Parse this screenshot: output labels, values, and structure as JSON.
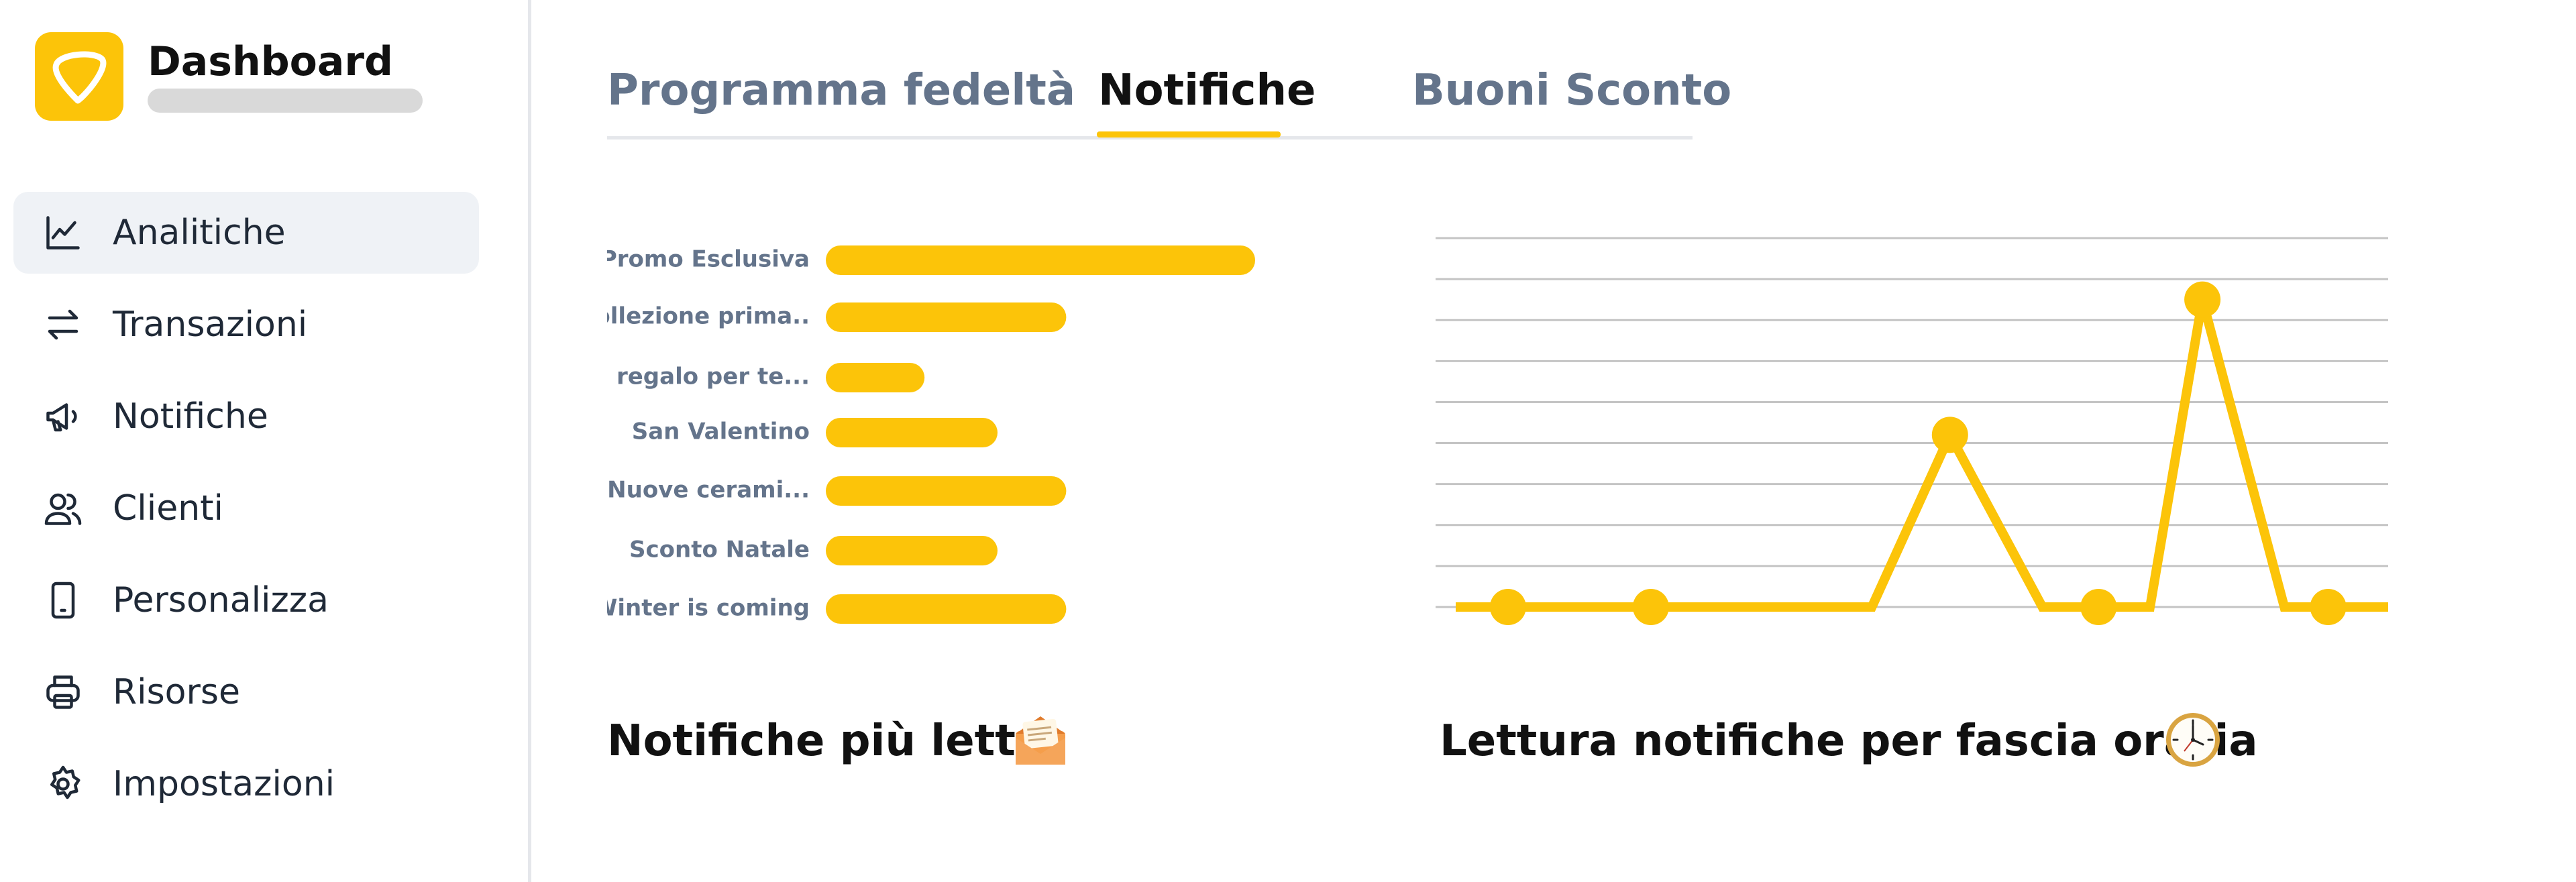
{
  "brand": {
    "title": "Dashboard"
  },
  "sidebar": {
    "items": [
      {
        "label": "Analitiche",
        "icon": "chart-line-icon",
        "active": true
      },
      {
        "label": "Transazioni",
        "icon": "arrows-exchange-icon"
      },
      {
        "label": "Notifiche",
        "icon": "megaphone-icon"
      },
      {
        "label": "Clienti",
        "icon": "users-icon"
      },
      {
        "label": "Personalizza",
        "icon": "smartphone-icon"
      },
      {
        "label": "Risorse",
        "icon": "printer-icon"
      },
      {
        "label": "Impostazioni",
        "icon": "gear-icon"
      }
    ]
  },
  "tabs": [
    {
      "label": "Programma fedeltà"
    },
    {
      "label": "Notifiche",
      "active": true
    },
    {
      "label": "Buoni Sconto"
    }
  ],
  "colors": {
    "accent": "#fcc409",
    "grid": "#c4c4c4",
    "muted_text": "#64748b"
  },
  "chart_data": [
    {
      "type": "bar",
      "orientation": "horizontal",
      "categories": [
        "Promo Esclusiva",
        "Collezione prima..",
        "Un regalo per te...",
        "San Valentino",
        "Nuove cerami...",
        "Sconto Natale",
        "Winter is coming"
      ],
      "values": [
        100,
        56,
        23,
        40,
        56,
        40,
        56
      ],
      "title": "Notifiche più lette",
      "title_icon": "envelope-letter-icon",
      "xlim": [
        0,
        100
      ]
    },
    {
      "type": "line",
      "x": [
        0,
        1,
        2,
        3,
        4,
        5,
        6,
        7,
        8,
        9,
        10,
        11,
        12
      ],
      "values": [
        0,
        0,
        0,
        0,
        0,
        0,
        0.75,
        0,
        0,
        0,
        0.75,
        0,
        0
      ],
      "series": [
        {
          "x": [
            0.0,
            0.076,
            0.226,
            0.367,
            0.458,
            0.54,
            0.637,
            0.696,
            0.75,
            0.805,
            0.891,
            0.937,
            1.0
          ],
          "y": [
            0,
            0,
            0,
            0,
            0,
            0.42,
            0,
            0,
            0,
            0.75,
            0,
            0,
            0
          ],
          "markers": [
            1,
            2,
            5,
            7,
            9,
            11
          ]
        }
      ],
      "ylim": [
        0,
        0.9
      ],
      "grid_lines": 10,
      "title": "Lettura notifiche per fascia oraria",
      "title_icon": "clock-icon"
    }
  ]
}
